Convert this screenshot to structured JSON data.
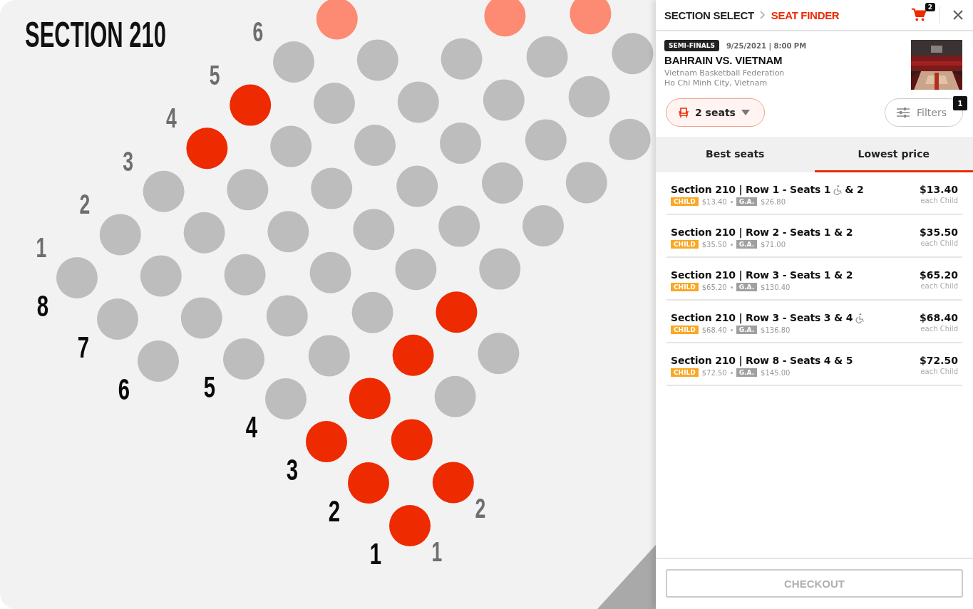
{
  "map": {
    "title": "SECTION 210",
    "rows": [
      {
        "label": "8",
        "seat_numbers": [
          "1",
          "2",
          "3",
          "4",
          "5",
          "6"
        ],
        "seats": [
          {
            "color": "#bdbdbd"
          },
          {
            "color": "#bdbdbd"
          },
          {
            "color": "#bdbdbd"
          },
          {
            "color": "#ee2a00"
          },
          {
            "color": "#ee2a00"
          },
          {
            "color": "#bdbdbd"
          },
          {
            "color": "#fd8a72"
          }
        ]
      },
      {
        "label": "7",
        "seats": [
          {
            "color": "#bdbdbd"
          },
          {
            "color": "#bdbdbd"
          },
          {
            "color": "#bdbdbd"
          },
          {
            "color": "#bdbdbd"
          },
          {
            "color": "#bdbdbd"
          },
          {
            "color": "#bdbdbd"
          },
          {
            "color": "#bdbdbd"
          }
        ]
      },
      {
        "label": "6",
        "seats": [
          {
            "color": "#bdbdbd"
          },
          {
            "color": "#bdbdbd"
          },
          {
            "color": "#bdbdbd"
          },
          {
            "color": "#bdbdbd"
          },
          {
            "color": "#bdbdbd"
          },
          {
            "color": "#bdbdbd"
          },
          {
            "color": "#bdbdbd"
          },
          {
            "color": "#bdbdbd"
          },
          {
            "color": "#fd8a72"
          }
        ]
      },
      {
        "label": "5",
        "seats": [
          {
            "color": "#bdbdbd"
          },
          {
            "color": "#bdbdbd"
          },
          {
            "color": "#bdbdbd"
          },
          {
            "color": "#bdbdbd"
          },
          {
            "color": "#bdbdbd"
          },
          {
            "color": "#bdbdbd"
          },
          {
            "color": "#bdbdbd"
          },
          {
            "color": "#bdbdbd"
          },
          {
            "color": "#fd8a72"
          }
        ]
      },
      {
        "label": "4",
        "seats": [
          {
            "color": "#bdbdbd"
          },
          {
            "color": "#bdbdbd"
          },
          {
            "color": "#bdbdbd"
          },
          {
            "color": "#bdbdbd"
          },
          {
            "color": "#bdbdbd"
          },
          {
            "color": "#bdbdbd"
          },
          {
            "color": "#bdbdbd"
          },
          {
            "color": "#bdbdbd"
          },
          {
            "color": "#bdbdbd"
          }
        ]
      },
      {
        "label": "3",
        "seats": [
          {
            "color": "#ee2a00"
          },
          {
            "color": "#ee2a00"
          },
          {
            "color": "#ee2a00"
          },
          {
            "color": "#ee2a00"
          },
          {
            "color": "#bdbdbd"
          },
          {
            "color": "#bdbdbd"
          },
          {
            "color": "#bdbdbd"
          },
          {
            "color": "#bdbdbd"
          }
        ]
      },
      {
        "label": "2",
        "seats": [
          {
            "color": "#ee2a00"
          },
          {
            "color": "#ee2a00"
          },
          {
            "color": "#bdbdbd"
          },
          {
            "color": "#bdbdbd"
          }
        ]
      },
      {
        "label": "1",
        "seat_numbers": [
          "1",
          "2"
        ],
        "seats": [
          {
            "color": "#ee2a00"
          },
          {
            "color": "#ee2a00"
          }
        ]
      }
    ]
  },
  "panel": {
    "breadcrumb": [
      {
        "label": "SECTION SELECT",
        "selected": false
      },
      {
        "label": "SEAT FINDER",
        "selected": true
      }
    ],
    "cart_count": "2",
    "event": {
      "badge": "SEMI-FINALS",
      "datetime": "9/25/2021 | 8:00 PM",
      "title": "BAHRAIN VS. VIETNAM",
      "organizer": "Vietnam Basketball Federation",
      "location": "Ho Chi Minh City, Vietnam"
    },
    "seats_dropdown": {
      "value": "2 seats"
    },
    "filters": {
      "label": "Filters",
      "count": "1"
    },
    "tabs": [
      {
        "label": "Best seats",
        "selected": false
      },
      {
        "label": "Lowest price",
        "selected": true
      }
    ],
    "listings": [
      {
        "title": "Section 210 | Row 1 - Seats 1",
        "title_end": "& 2",
        "accessible": true,
        "child_tag": "CHILD",
        "child_price": "$13.40",
        "ga_tag": "G.A.",
        "ga_price": "$26.80",
        "price": "$13.40",
        "price_note": "each Child"
      },
      {
        "title": "Section 210 | Row 2 - Seats 1 & 2",
        "accessible": false,
        "child_tag": "CHILD",
        "child_price": "$35.50",
        "ga_tag": "G.A.",
        "ga_price": "$71.00",
        "price": "$35.50",
        "price_note": "each Child"
      },
      {
        "title": "Section 210 | Row 3 - Seats 1 & 2",
        "accessible": false,
        "child_tag": "CHILD",
        "child_price": "$65.20",
        "ga_tag": "G.A.",
        "ga_price": "$130.40",
        "price": "$65.20",
        "price_note": "each Child"
      },
      {
        "title": "Section 210 | Row 3 - Seats 3 & 4",
        "accessible": true,
        "child_tag": "CHILD",
        "child_price": "$68.40",
        "ga_tag": "G.A.",
        "ga_price": "$136.80",
        "price": "$68.40",
        "price_note": "each Child"
      },
      {
        "title": "Section 210 | Row 8 - Seats 4 & 5",
        "accessible": false,
        "child_tag": "CHILD",
        "child_price": "$72.50",
        "ga_tag": "G.A.",
        "ga_price": "$145.00",
        "price": "$72.50",
        "price_note": "each Child"
      }
    ],
    "checkout": {
      "label": "CHECKOUT",
      "disabled": true
    }
  }
}
